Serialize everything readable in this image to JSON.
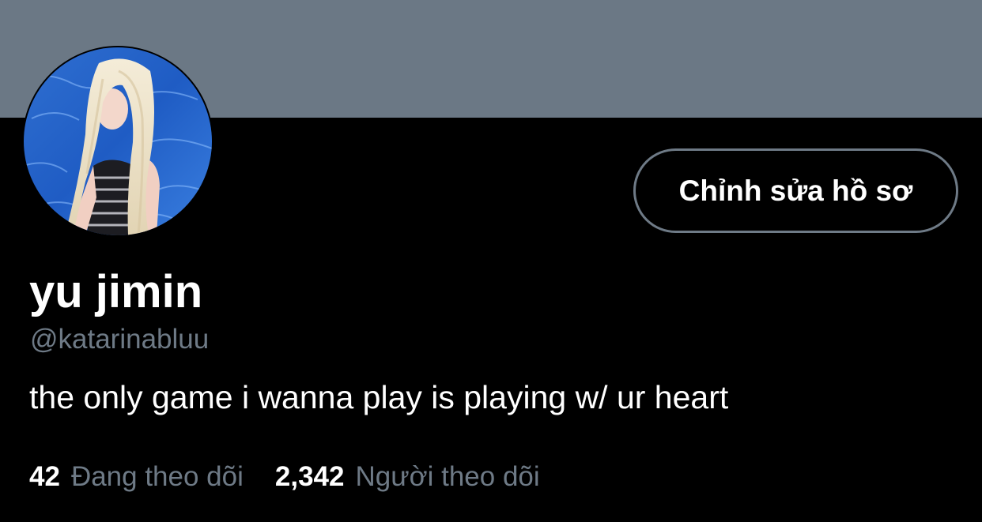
{
  "profile": {
    "display_name": "yu jimin",
    "handle": "@katarinabluu",
    "bio": "the only game i wanna play is playing w/ ur heart",
    "edit_button_label": "Chỉnh sửa hồ sơ",
    "avatar_label": "profile photo"
  },
  "stats": {
    "following_count": "42",
    "following_label": "Đang theo dõi",
    "followers_count": "2,342",
    "followers_label": "Người theo dõi"
  },
  "colors": {
    "banner": "#6b7885",
    "background": "#000000",
    "secondary_text": "#6e7a86",
    "primary_text": "#ffffff"
  }
}
